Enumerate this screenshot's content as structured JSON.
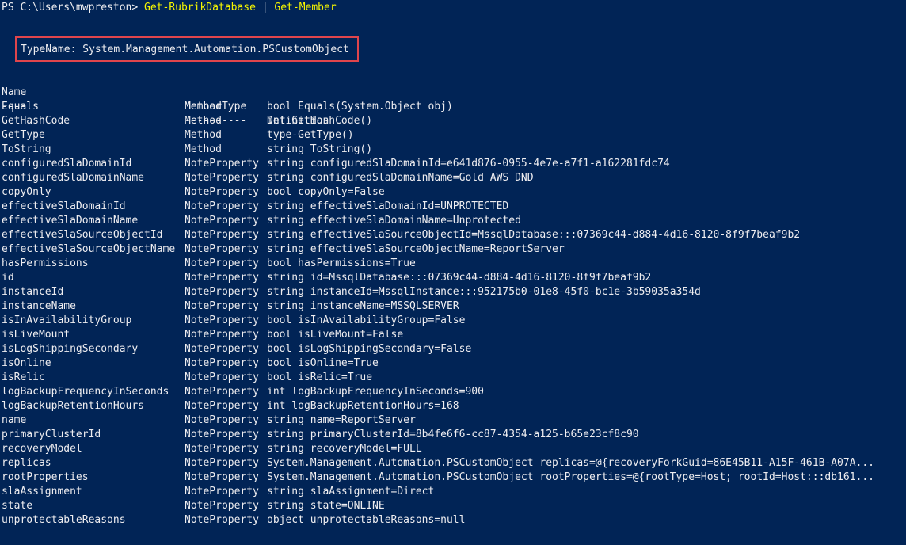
{
  "prompt": {
    "path": "PS C:\\Users\\mwpreston> ",
    "command1": "Get-RubrikDatabase",
    "pipe": " | ",
    "command2": "Get-Member"
  },
  "typename": "TypeName: System.Management.Automation.PSCustomObject",
  "colors": {
    "background": "#012456",
    "text": "#eeedf0",
    "command": "#f6f600",
    "highlight_box": "#e0454c"
  },
  "table": {
    "headers": [
      "Name",
      "MemberType",
      "Definition"
    ],
    "separators": [
      "----",
      "----------",
      "----------"
    ],
    "rows": [
      {
        "name": "Equals",
        "type": "Method",
        "def": "bool Equals(System.Object obj)"
      },
      {
        "name": "GetHashCode",
        "type": "Method",
        "def": "int GetHashCode()"
      },
      {
        "name": "GetType",
        "type": "Method",
        "def": "type GetType()"
      },
      {
        "name": "ToString",
        "type": "Method",
        "def": "string ToString()"
      },
      {
        "name": "configuredSlaDomainId",
        "type": "NoteProperty",
        "def": "string configuredSlaDomainId=e641d876-0955-4e7e-a7f1-a162281fdc74"
      },
      {
        "name": "configuredSlaDomainName",
        "type": "NoteProperty",
        "def": "string configuredSlaDomainName=Gold AWS DND"
      },
      {
        "name": "copyOnly",
        "type": "NoteProperty",
        "def": "bool copyOnly=False"
      },
      {
        "name": "effectiveSlaDomainId",
        "type": "NoteProperty",
        "def": "string effectiveSlaDomainId=UNPROTECTED"
      },
      {
        "name": "effectiveSlaDomainName",
        "type": "NoteProperty",
        "def": "string effectiveSlaDomainName=Unprotected"
      },
      {
        "name": "effectiveSlaSourceObjectId",
        "type": "NoteProperty",
        "def": "string effectiveSlaSourceObjectId=MssqlDatabase:::07369c44-d884-4d16-8120-8f9f7beaf9b2"
      },
      {
        "name": "effectiveSlaSourceObjectName",
        "type": "NoteProperty",
        "def": "string effectiveSlaSourceObjectName=ReportServer"
      },
      {
        "name": "hasPermissions",
        "type": "NoteProperty",
        "def": "bool hasPermissions=True"
      },
      {
        "name": "id",
        "type": "NoteProperty",
        "def": "string id=MssqlDatabase:::07369c44-d884-4d16-8120-8f9f7beaf9b2"
      },
      {
        "name": "instanceId",
        "type": "NoteProperty",
        "def": "string instanceId=MssqlInstance:::952175b0-01e8-45f0-bc1e-3b59035a354d"
      },
      {
        "name": "instanceName",
        "type": "NoteProperty",
        "def": "string instanceName=MSSQLSERVER"
      },
      {
        "name": "isInAvailabilityGroup",
        "type": "NoteProperty",
        "def": "bool isInAvailabilityGroup=False"
      },
      {
        "name": "isLiveMount",
        "type": "NoteProperty",
        "def": "bool isLiveMount=False"
      },
      {
        "name": "isLogShippingSecondary",
        "type": "NoteProperty",
        "def": "bool isLogShippingSecondary=False"
      },
      {
        "name": "isOnline",
        "type": "NoteProperty",
        "def": "bool isOnline=True"
      },
      {
        "name": "isRelic",
        "type": "NoteProperty",
        "def": "bool isRelic=True"
      },
      {
        "name": "logBackupFrequencyInSeconds",
        "type": "NoteProperty",
        "def": "int logBackupFrequencyInSeconds=900"
      },
      {
        "name": "logBackupRetentionHours",
        "type": "NoteProperty",
        "def": "int logBackupRetentionHours=168"
      },
      {
        "name": "name",
        "type": "NoteProperty",
        "def": "string name=ReportServer"
      },
      {
        "name": "primaryClusterId",
        "type": "NoteProperty",
        "def": "string primaryClusterId=8b4fe6f6-cc87-4354-a125-b65e23cf8c90"
      },
      {
        "name": "recoveryModel",
        "type": "NoteProperty",
        "def": "string recoveryModel=FULL"
      },
      {
        "name": "replicas",
        "type": "NoteProperty",
        "def": "System.Management.Automation.PSCustomObject replicas=@{recoveryForkGuid=86E45B11-A15F-461B-A07A..."
      },
      {
        "name": "rootProperties",
        "type": "NoteProperty",
        "def": "System.Management.Automation.PSCustomObject rootProperties=@{rootType=Host; rootId=Host:::db161..."
      },
      {
        "name": "slaAssignment",
        "type": "NoteProperty",
        "def": "string slaAssignment=Direct"
      },
      {
        "name": "state",
        "type": "NoteProperty",
        "def": "string state=ONLINE"
      },
      {
        "name": "unprotectableReasons",
        "type": "NoteProperty",
        "def": "object unprotectableReasons=null"
      }
    ]
  }
}
